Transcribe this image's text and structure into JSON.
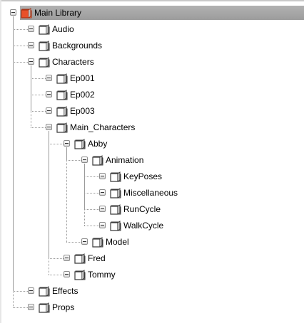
{
  "tree": {
    "nodes": [
      {
        "label": "Main Library",
        "depth": 0,
        "selected": true,
        "icon": "library-folder-icon",
        "color": "#e8502a"
      },
      {
        "label": "Audio",
        "depth": 1,
        "icon": "folder-icon"
      },
      {
        "label": "Backgrounds",
        "depth": 1,
        "icon": "folder-icon"
      },
      {
        "label": "Characters",
        "depth": 1,
        "icon": "folder-icon"
      },
      {
        "label": "Ep001",
        "depth": 2,
        "icon": "folder-icon"
      },
      {
        "label": "Ep002",
        "depth": 2,
        "icon": "folder-icon"
      },
      {
        "label": "Ep003",
        "depth": 2,
        "icon": "folder-icon"
      },
      {
        "label": "Main_Characters",
        "depth": 2,
        "icon": "folder-icon"
      },
      {
        "label": "Abby",
        "depth": 3,
        "icon": "folder-icon"
      },
      {
        "label": "Animation",
        "depth": 4,
        "icon": "folder-icon"
      },
      {
        "label": "KeyPoses",
        "depth": 5,
        "icon": "folder-icon"
      },
      {
        "label": "Miscellaneous",
        "depth": 5,
        "icon": "folder-icon"
      },
      {
        "label": "RunCycle",
        "depth": 5,
        "icon": "folder-icon"
      },
      {
        "label": "WalkCycle",
        "depth": 5,
        "icon": "folder-icon"
      },
      {
        "label": "Model",
        "depth": 4,
        "icon": "folder-icon"
      },
      {
        "label": "Fred",
        "depth": 3,
        "icon": "folder-icon"
      },
      {
        "label": "Tommy",
        "depth": 3,
        "icon": "folder-icon"
      },
      {
        "label": "Effects",
        "depth": 1,
        "icon": "folder-icon"
      },
      {
        "label": "Props",
        "depth": 1,
        "icon": "folder-icon"
      }
    ]
  },
  "colors": {
    "selection": "#a8a8a8",
    "accent": "#e8502a",
    "folder": "#6e6e6e"
  }
}
